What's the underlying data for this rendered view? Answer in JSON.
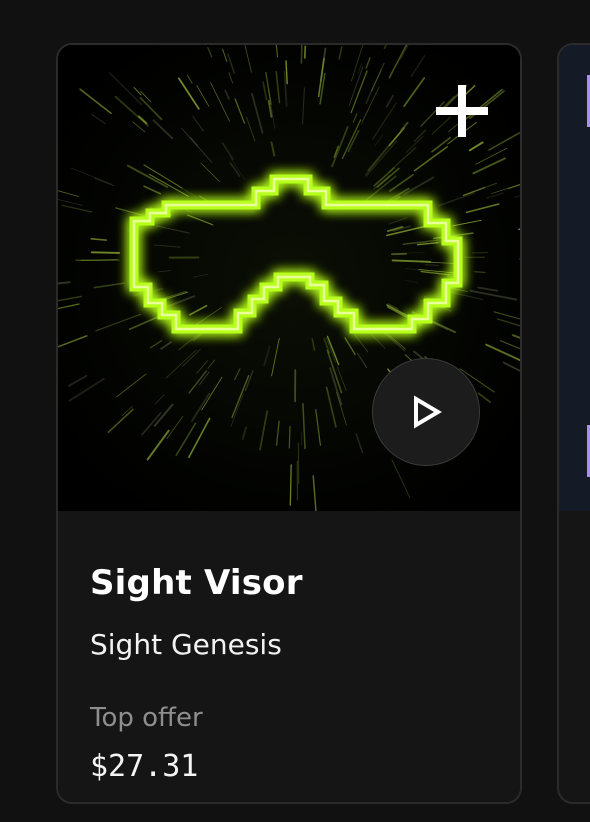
{
  "card": {
    "title": "Sight Visor",
    "collection": "Sight Genesis",
    "offer_label": "Top offer",
    "price": "$27.31",
    "artwork": {
      "subject": "pixelated-visor",
      "glow_color": "#b6ff1a",
      "background_color": "#000000"
    },
    "add_icon": "plus-icon",
    "play_icon": "play-icon"
  },
  "next_card": {
    "accent_color": "#a990f0"
  }
}
